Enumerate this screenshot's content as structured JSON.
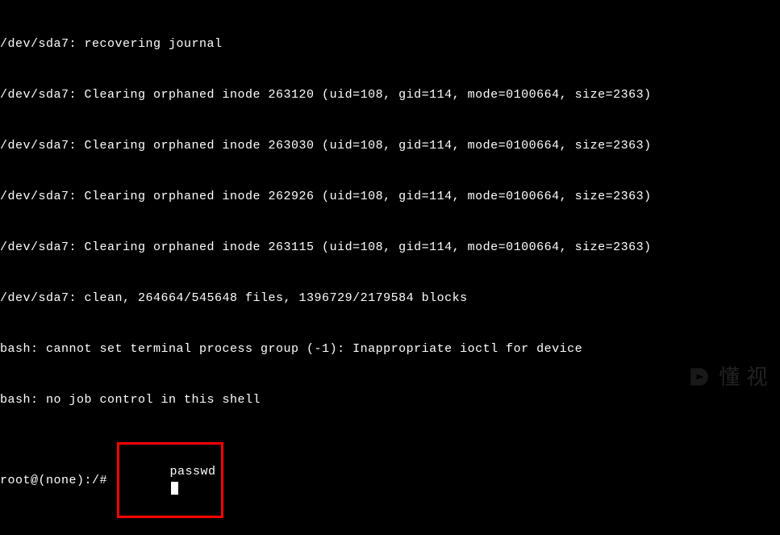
{
  "terminal": {
    "lines": [
      "/dev/sda7: recovering journal",
      "/dev/sda7: Clearing orphaned inode 263120 (uid=108, gid=114, mode=0100664, size=2363)",
      "/dev/sda7: Clearing orphaned inode 263030 (uid=108, gid=114, mode=0100664, size=2363)",
      "/dev/sda7: Clearing orphaned inode 262926 (uid=108, gid=114, mode=0100664, size=2363)",
      "/dev/sda7: Clearing orphaned inode 263115 (uid=108, gid=114, mode=0100664, size=2363)",
      "/dev/sda7: clean, 264664/545648 files, 1396729/2179584 blocks",
      "bash: cannot set terminal process group (-1): Inappropriate ioctl for device",
      "bash: no job control in this shell"
    ],
    "prompt": "root@(none):/# ",
    "command": "passwd"
  },
  "watermark": {
    "text": "懂 视"
  }
}
